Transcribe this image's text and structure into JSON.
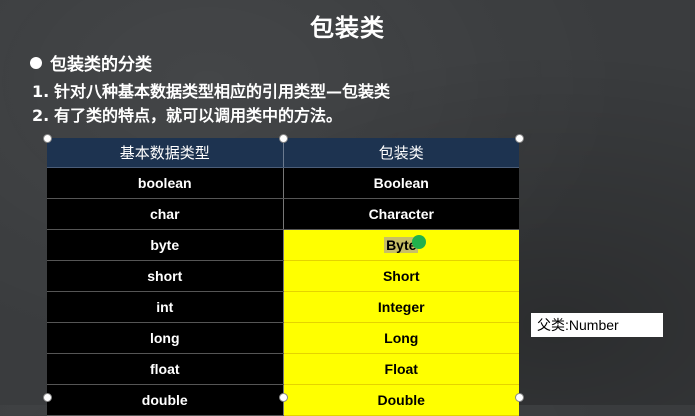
{
  "slide": {
    "title": "包装类",
    "heading": "包装类的分类",
    "points": [
      {
        "num": "1.",
        "text": "针对八种基本数据类型相应的引用类型—包装类"
      },
      {
        "num": "2.",
        "text": "有了类的特点，就可以调用类中的方法。"
      }
    ]
  },
  "table": {
    "headers": [
      "基本数据类型",
      "包装类"
    ],
    "rows": [
      [
        "boolean",
        "Boolean"
      ],
      [
        "char",
        "Character"
      ],
      [
        "byte",
        "Byte"
      ],
      [
        "short",
        "Short"
      ],
      [
        "int",
        "Integer"
      ],
      [
        "long",
        "Long"
      ],
      [
        "float",
        "Float"
      ],
      [
        "double",
        "Double"
      ]
    ]
  },
  "note": "父类:Number",
  "colors": {
    "header_bg": "#1d3350",
    "highlight": "#ffff00",
    "dark_cell": "#000000"
  }
}
